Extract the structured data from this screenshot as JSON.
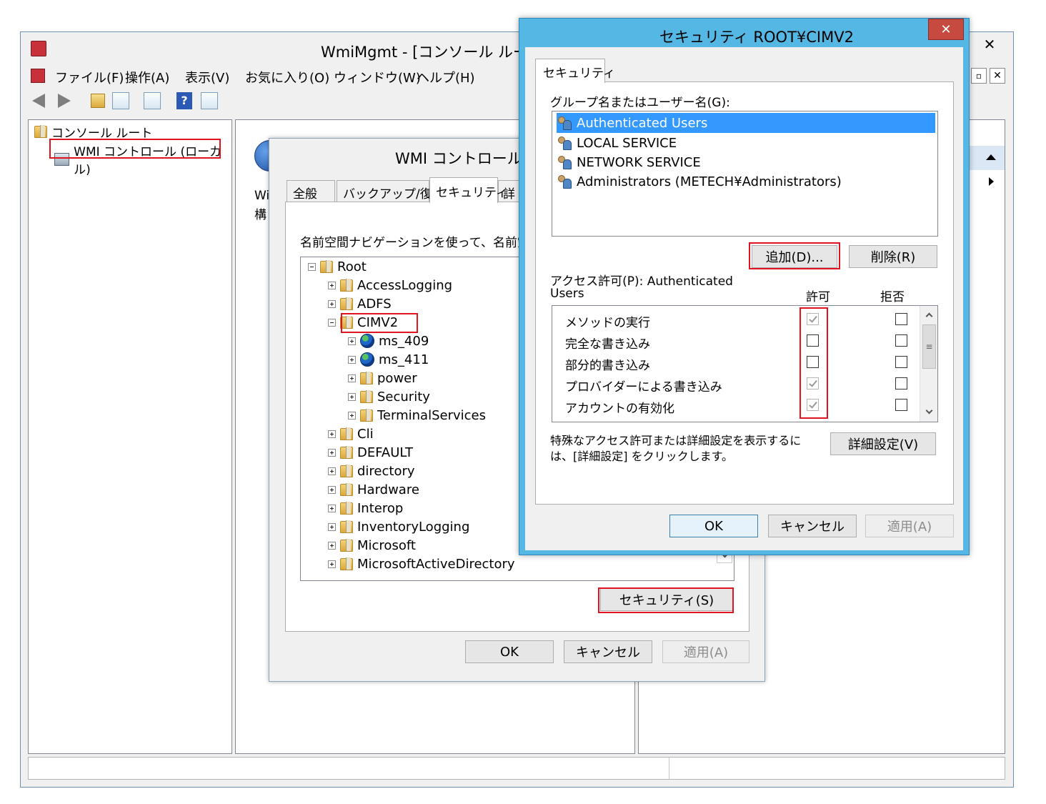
{
  "mmc": {
    "title": "WmiMgmt - [コンソール ルート",
    "menu": [
      "ファイル(F)",
      "操作(A)",
      "表示(V)",
      "お気に入り(O)",
      "ウィンドウ(W)",
      "ヘルプ(H)"
    ],
    "tree_root": "コンソール ルート",
    "tree_child": "WMI コントロール (ローカル)",
    "close": "✕"
  },
  "behind_text": {
    "line1": "Wi",
    "line2": "構"
  },
  "wmi_dialog": {
    "title": "WMI コントロール (",
    "tabs": [
      "全般",
      "バックアップ/復元",
      "セキュリティ",
      "詳"
    ],
    "instruction": "名前空間ナビゲーションを使って、名前空間に",
    "tree": [
      "Root",
      "AccessLogging",
      "ADFS",
      "CIMV2",
      "ms_409",
      "ms_411",
      "power",
      "Security",
      "TerminalServices",
      "Cli",
      "DEFAULT",
      "directory",
      "Hardware",
      "Interop",
      "InventoryLogging",
      "Microsoft",
      "MicrosoftActiveDirectory"
    ],
    "security_button": "セキュリティ(S)",
    "ok": "OK",
    "cancel": "キャンセル",
    "apply": "適用(A)"
  },
  "sec_dialog": {
    "title": "セキュリティ ROOT¥CIMV2",
    "close": "✕",
    "tab": "セキュリティ",
    "group_label": "グループ名またはユーザー名(G):",
    "users": [
      "Authenticated Users",
      "LOCAL SERVICE",
      "NETWORK SERVICE",
      "Administrators (METECH¥Administrators)"
    ],
    "selected_user_index": 0,
    "add_button": "追加(D)...",
    "remove_button": "削除(R)",
    "perm_label_line1": "アクセス許可(P): Authenticated",
    "perm_label_line2": "Users",
    "allow_header": "許可",
    "deny_header": "拒否",
    "permissions": [
      {
        "name": "メソッドの実行",
        "allow": true,
        "deny": false
      },
      {
        "name": "完全な書き込み",
        "allow": false,
        "deny": false
      },
      {
        "name": "部分的書き込み",
        "allow": false,
        "deny": false
      },
      {
        "name": "プロバイダーによる書き込み",
        "allow": true,
        "deny": false
      },
      {
        "name": "アカウントの有効化",
        "allow": true,
        "deny": false
      }
    ],
    "advanced_text_line1": "特殊なアクセス許可または詳細設定を表示するに",
    "advanced_text_line2": "は、[詳細設定] をクリックします。",
    "advanced_button": "詳細設定(V)",
    "ok": "OK",
    "cancel": "キャンセル",
    "apply": "適用(A)"
  }
}
